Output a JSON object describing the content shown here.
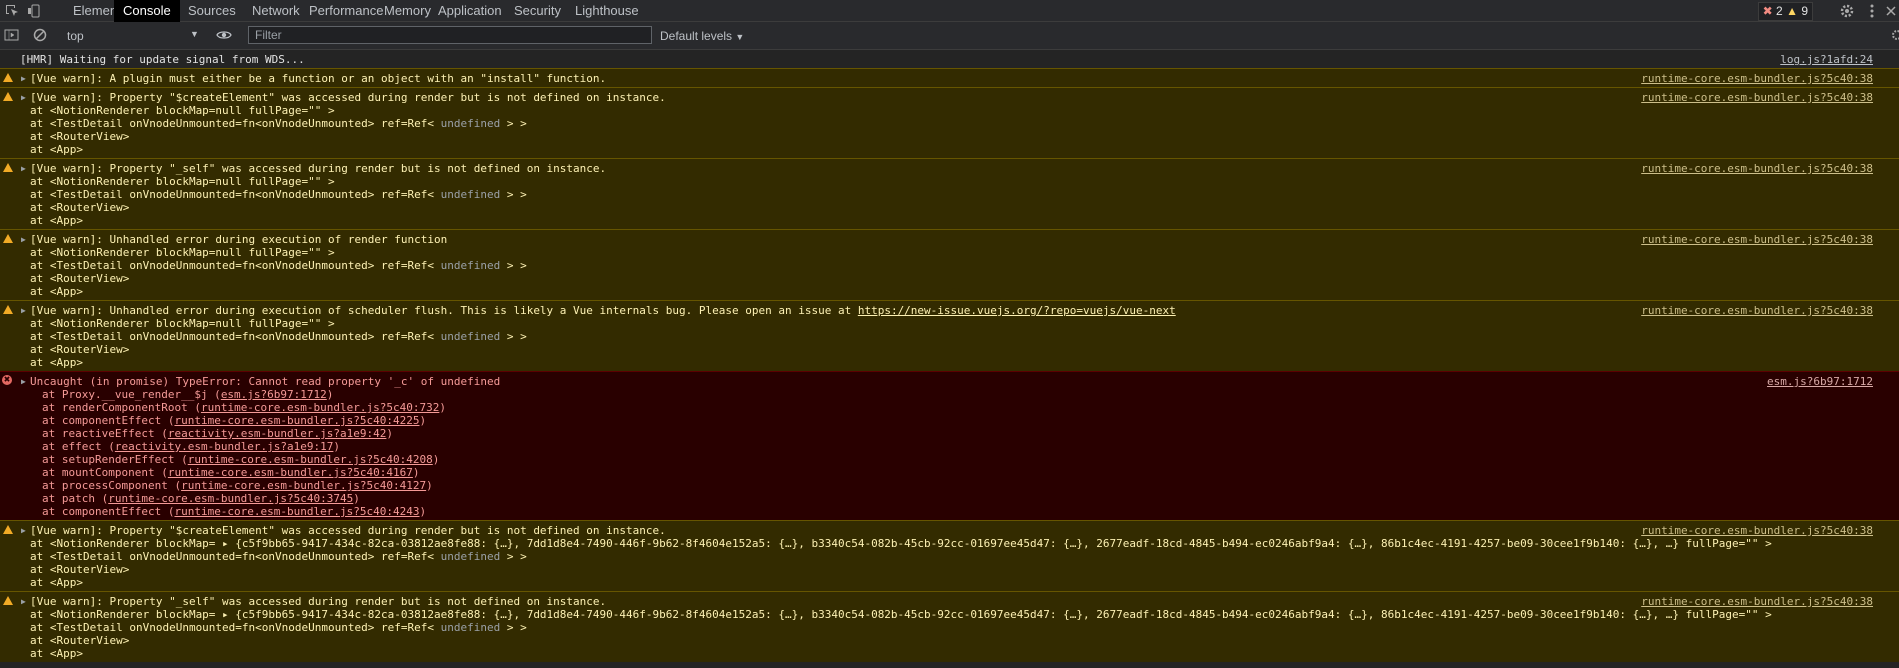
{
  "tabs": [
    "Elements",
    "Console",
    "Sources",
    "Network",
    "Performance",
    "Memory",
    "Application",
    "Security",
    "Lighthouse"
  ],
  "active_tab": "Console",
  "badges": {
    "errors": "2",
    "warnings": "9"
  },
  "toolbar": {
    "context": "top",
    "filter_placeholder": "Filter",
    "levels": "Default levels"
  },
  "icons": [
    "inspect-element-icon",
    "device-toolbar-icon",
    "sidebar-toggle-icon",
    "clear-console-icon",
    "eye-icon",
    "gear-icon",
    "kebab-menu-icon",
    "close-icon"
  ],
  "colors": {
    "warn_bg": "#332b00",
    "error_bg": "#290000",
    "warn_icon": "#f2ab26",
    "error_icon": "#e46962"
  },
  "messages": [
    {
      "level": "info",
      "text": "[HMR] Waiting for update signal from WDS...",
      "source": "log.js?1afd:24"
    },
    {
      "level": "warn",
      "text": "[Vue warn]: A plugin must either be a function or an object with an \"install\" function.",
      "source": "runtime-core.esm-bundler.js?5c40:38"
    },
    {
      "level": "warn",
      "text": "[Vue warn]: Property \"$createElement\" was accessed during render but is not defined on instance.",
      "source": "runtime-core.esm-bundler.js?5c40:38",
      "trace": [
        "at <NotionRenderer blockMap=null fullPage=\"\" >",
        "at <TestDetail onVnodeUnmounted=fn<onVnodeUnmounted> ref=Ref< undefined > >",
        "at <RouterView>",
        "at <App>"
      ]
    },
    {
      "level": "warn",
      "text": "[Vue warn]: Property \"_self\" was accessed during render but is not defined on instance.",
      "source": "runtime-core.esm-bundler.js?5c40:38",
      "trace": [
        "at <NotionRenderer blockMap=null fullPage=\"\" >",
        "at <TestDetail onVnodeUnmounted=fn<onVnodeUnmounted> ref=Ref< undefined > >",
        "at <RouterView>",
        "at <App>"
      ]
    },
    {
      "level": "warn",
      "text": "[Vue warn]: Unhandled error during execution of render function",
      "source": "runtime-core.esm-bundler.js?5c40:38",
      "trace": [
        "at <NotionRenderer blockMap=null fullPage=\"\" >",
        "at <TestDetail onVnodeUnmounted=fn<onVnodeUnmounted> ref=Ref< undefined > >",
        "at <RouterView>",
        "at <App>"
      ]
    },
    {
      "level": "warn",
      "text": "[Vue warn]: Unhandled error during execution of scheduler flush. This is likely a Vue internals bug. Please open an issue at ",
      "link": "https://new-issue.vuejs.org/?repo=vuejs/vue-next",
      "source": "runtime-core.esm-bundler.js?5c40:38",
      "trace": [
        "at <NotionRenderer blockMap=null fullPage=\"\" >",
        "at <TestDetail onVnodeUnmounted=fn<onVnodeUnmounted> ref=Ref< undefined > >",
        "at <RouterView>",
        "at <App>"
      ]
    },
    {
      "level": "error",
      "text": "Uncaught (in promise) TypeError: Cannot read property '_c' of undefined",
      "source": "esm.js?6b97:1712",
      "stack": [
        [
          "at Proxy.__vue_render__$j (",
          "esm.js?6b97:1712",
          ")"
        ],
        [
          "at renderComponentRoot (",
          "runtime-core.esm-bundler.js?5c40:732",
          ")"
        ],
        [
          "at componentEffect (",
          "runtime-core.esm-bundler.js?5c40:4225",
          ")"
        ],
        [
          "at reactiveEffect (",
          "reactivity.esm-bundler.js?a1e9:42",
          ")"
        ],
        [
          "at effect (",
          "reactivity.esm-bundler.js?a1e9:17",
          ")"
        ],
        [
          "at setupRenderEffect (",
          "runtime-core.esm-bundler.js?5c40:4208",
          ")"
        ],
        [
          "at mountComponent (",
          "runtime-core.esm-bundler.js?5c40:4167",
          ")"
        ],
        [
          "at processComponent (",
          "runtime-core.esm-bundler.js?5c40:4127",
          ")"
        ],
        [
          "at patch (",
          "runtime-core.esm-bundler.js?5c40:3745",
          ")"
        ],
        [
          "at componentEffect (",
          "runtime-core.esm-bundler.js?5c40:4243",
          ")"
        ]
      ]
    },
    {
      "level": "warn",
      "text": "[Vue warn]: Property \"$createElement\" was accessed during render but is not defined on instance.",
      "source": "runtime-core.esm-bundler.js?5c40:38",
      "trace": [
        "at <NotionRenderer blockMap= ▸ {c5f9bb65-9417-434c-82ca-03812ae8fe88: {…}, 7dd1d8e4-7490-446f-9b62-8f4604e152a5: {…}, b3340c54-082b-45cb-92cc-01697ee45d47: {…}, 2677eadf-18cd-4845-b494-ec0246abf9a4: {…}, 86b1c4ec-4191-4257-be09-30cee1f9b140: {…}, …} fullPage=\"\" >",
        "at <TestDetail onVnodeUnmounted=fn<onVnodeUnmounted> ref=Ref< undefined > >",
        "at <RouterView>",
        "at <App>"
      ]
    },
    {
      "level": "warn",
      "text": "[Vue warn]: Property \"_self\" was accessed during render but is not defined on instance.",
      "source": "runtime-core.esm-bundler.js?5c40:38",
      "trace": [
        "at <NotionRenderer blockMap= ▸ {c5f9bb65-9417-434c-82ca-03812ae8fe88: {…}, 7dd1d8e4-7490-446f-9b62-8f4604e152a5: {…}, b3340c54-082b-45cb-92cc-01697ee45d47: {…}, 2677eadf-18cd-4845-b494-ec0246abf9a4: {…}, 86b1c4ec-4191-4257-be09-30cee1f9b140: {…}, …} fullPage=\"\" >",
        "at <TestDetail onVnodeUnmounted=fn<onVnodeUnmounted> ref=Ref< undefined > >",
        "at <RouterView>",
        "at <App>"
      ]
    }
  ]
}
